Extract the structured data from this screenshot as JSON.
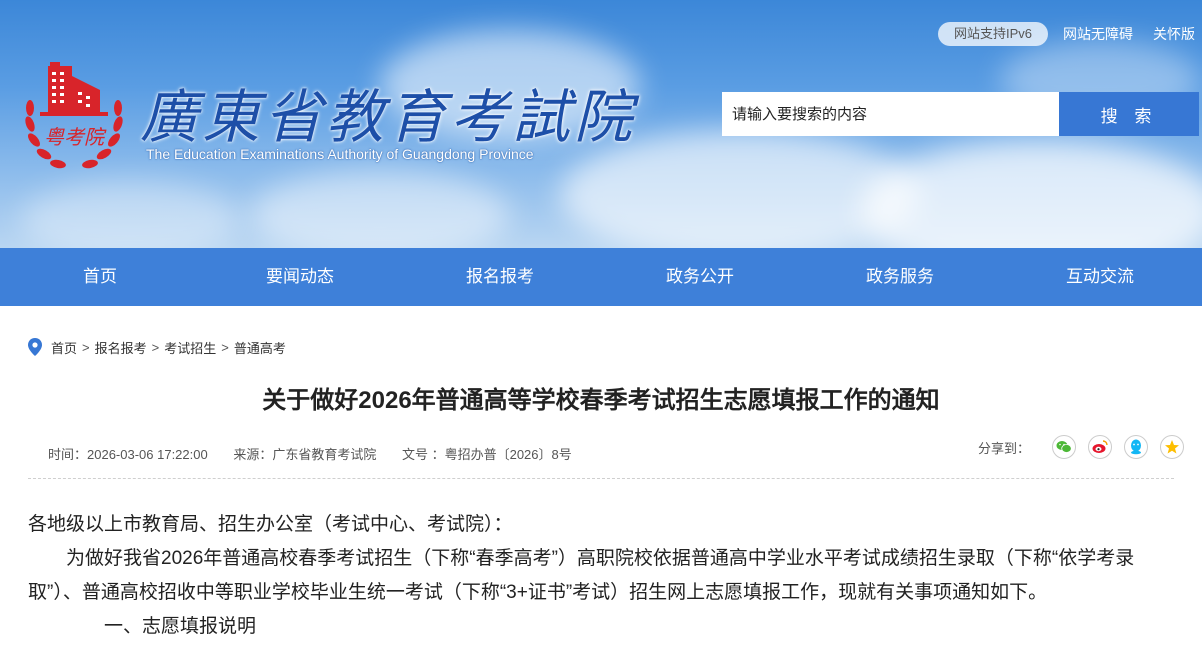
{
  "header": {
    "title": "廣東省教育考試院",
    "subtitle": "The Education Examinations Authority of Guangdong Province",
    "emblem_text": "粤考院",
    "ipv6_label": "网站支持IPv6",
    "accessibility_label": "网站无障碍",
    "care_label": "关怀版",
    "search": {
      "placeholder": "请输入要搜索的内容",
      "button_label": "搜 索"
    }
  },
  "nav": {
    "items": [
      {
        "label": "首页"
      },
      {
        "label": "要闻动态"
      },
      {
        "label": "报名报考"
      },
      {
        "label": "政务公开"
      },
      {
        "label": "政务服务"
      },
      {
        "label": "互动交流"
      }
    ]
  },
  "breadcrumb": [
    "首页",
    "报名报考",
    "考试招生",
    "普通高考"
  ],
  "breadcrumb_separator": ">",
  "article": {
    "title": "关于做好2026年普通高等学校春季考试招生志愿填报工作的通知",
    "meta": {
      "time": "时间：2026-03-06 17:22:00",
      "source": "来源：广东省教育考试院",
      "doc_no": "文号 ：粤招办普〔2026〕8号"
    },
    "share_label": "分享到：",
    "share_icons": [
      "wechat-icon",
      "weibo-icon",
      "qq-icon",
      "qzone-icon"
    ],
    "paragraphs": [
      "各地级以上市教育局、招生办公室（考试中心、考试院）：",
      "为做好我省2026年普通高校春季考试招生（下称“春季高考”）高职院校依据普通高中学业水平考试成绩招生录取（下称“依学考录取”）、普通高校招收中等职业学校毕业生统一考试（下称“3+证书”考试）招生网上志愿填报工作，现就有关事项通知如下。",
      "一、志愿填报说明"
    ]
  },
  "colors": {
    "nav_bg": "#3e80d9",
    "search_button_bg": "#3777d4",
    "title_blue": "#1d4fa8",
    "emblem_red": "#d8242a",
    "location_pin": "#3777d4"
  }
}
